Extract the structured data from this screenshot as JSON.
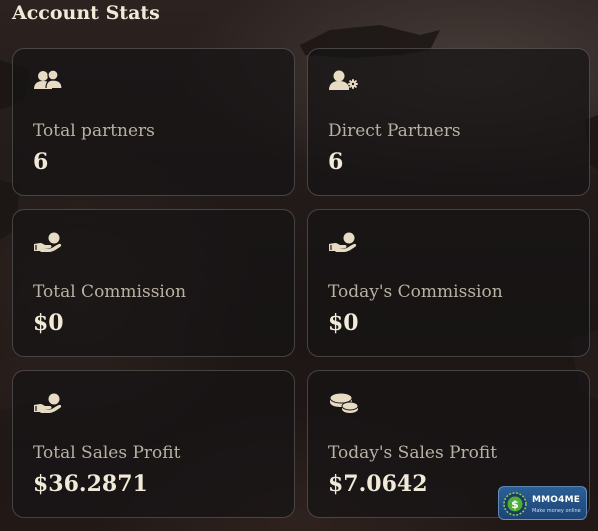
{
  "section": {
    "title": "Account Stats"
  },
  "cards": [
    {
      "icon": "partners-icon",
      "label": "Total partners",
      "value": "6"
    },
    {
      "icon": "direct-partner-icon",
      "label": "Direct Partners",
      "value": "6"
    },
    {
      "icon": "commission-hand-icon",
      "label": "Total Commission",
      "value": "$0"
    },
    {
      "icon": "commission-hand-icon",
      "label": "Today's Commission",
      "value": "$0"
    },
    {
      "icon": "commission-hand-icon",
      "label": "Total Sales Profit",
      "value": "$36.2871"
    },
    {
      "icon": "coins-icon",
      "label": "Today's Sales Profit",
      "value": "$7.0642"
    }
  ],
  "watermark": {
    "name": "MMO4ME",
    "tagline": "Make money online"
  },
  "colors": {
    "icon": "#e7dcc3",
    "label": "#b9b1a3",
    "value": "#f1ead9",
    "card_border": "rgba(255,255,255,0.20)",
    "badge": "#245085"
  }
}
